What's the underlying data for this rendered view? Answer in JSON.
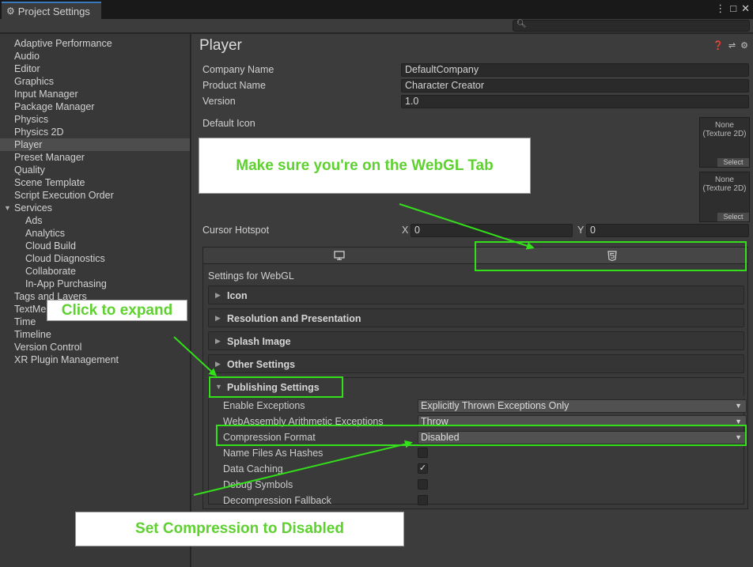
{
  "window": {
    "title": "Project Settings",
    "gear_icon": "gear-icon",
    "controls": [
      "⋮",
      "□",
      "✕"
    ]
  },
  "search": {
    "placeholder": ""
  },
  "sidebar": {
    "items": [
      {
        "label": "Adaptive Performance"
      },
      {
        "label": "Audio"
      },
      {
        "label": "Editor"
      },
      {
        "label": "Graphics"
      },
      {
        "label": "Input Manager"
      },
      {
        "label": "Package Manager"
      },
      {
        "label": "Physics"
      },
      {
        "label": "Physics 2D"
      },
      {
        "label": "Player"
      },
      {
        "label": "Preset Manager"
      },
      {
        "label": "Quality"
      },
      {
        "label": "Scene Template"
      },
      {
        "label": "Script Execution Order"
      },
      {
        "label": "Services"
      },
      {
        "label": "Ads"
      },
      {
        "label": "Analytics"
      },
      {
        "label": "Cloud Build"
      },
      {
        "label": "Cloud Diagnostics"
      },
      {
        "label": "Collaborate"
      },
      {
        "label": "In-App Purchasing"
      },
      {
        "label": "Tags and Layers"
      },
      {
        "label": "TextMe"
      },
      {
        "label": "Time"
      },
      {
        "label": "Timeline"
      },
      {
        "label": "Version Control"
      },
      {
        "label": "XR Plugin Management"
      }
    ],
    "selected": "Player"
  },
  "main": {
    "title": "Player",
    "company_name_label": "Company Name",
    "company_name_value": "DefaultCompany",
    "product_name_label": "Product Name",
    "product_name_value": "Character Creator",
    "version_label": "Version",
    "version_value": "1.0",
    "default_icon_label": "Default Icon",
    "texture_slot_1": {
      "name": "None\n(Texture 2D)",
      "select": "Select"
    },
    "texture_slot_2": {
      "name": "None\n(Texture 2D)",
      "select": "Select"
    },
    "cursor_hotspot_label": "Cursor Hotspot",
    "x_label": "X",
    "x_value": "0",
    "y_label": "Y",
    "y_value": "0",
    "settings_for": "Settings for WebGL",
    "foldouts": {
      "icon": "Icon",
      "resolution": "Resolution and Presentation",
      "splash": "Splash Image",
      "other": "Other Settings",
      "publishing": "Publishing Settings"
    },
    "publishing": {
      "enable_exceptions_label": "Enable Exceptions",
      "enable_exceptions_value": "Explicitly Thrown Exceptions Only",
      "wasm_arith_label": "WebAssembly Arithmetic Exceptions",
      "wasm_arith_value": "Throw",
      "compression_label": "Compression Format",
      "compression_value": "Disabled",
      "name_files_label": "Name Files As Hashes",
      "name_files_checked": false,
      "data_caching_label": "Data Caching",
      "data_caching_checked": true,
      "debug_symbols_label": "Debug Symbols",
      "debug_symbols_checked": false,
      "decompression_label": "Decompression Fallback",
      "decompression_checked": false
    }
  },
  "annotations": {
    "webgl_tab": "Make sure you're on the WebGL Tab",
    "expand": "Click to expand",
    "compression": "Set Compression to Disabled",
    "color": "#33e01a"
  }
}
